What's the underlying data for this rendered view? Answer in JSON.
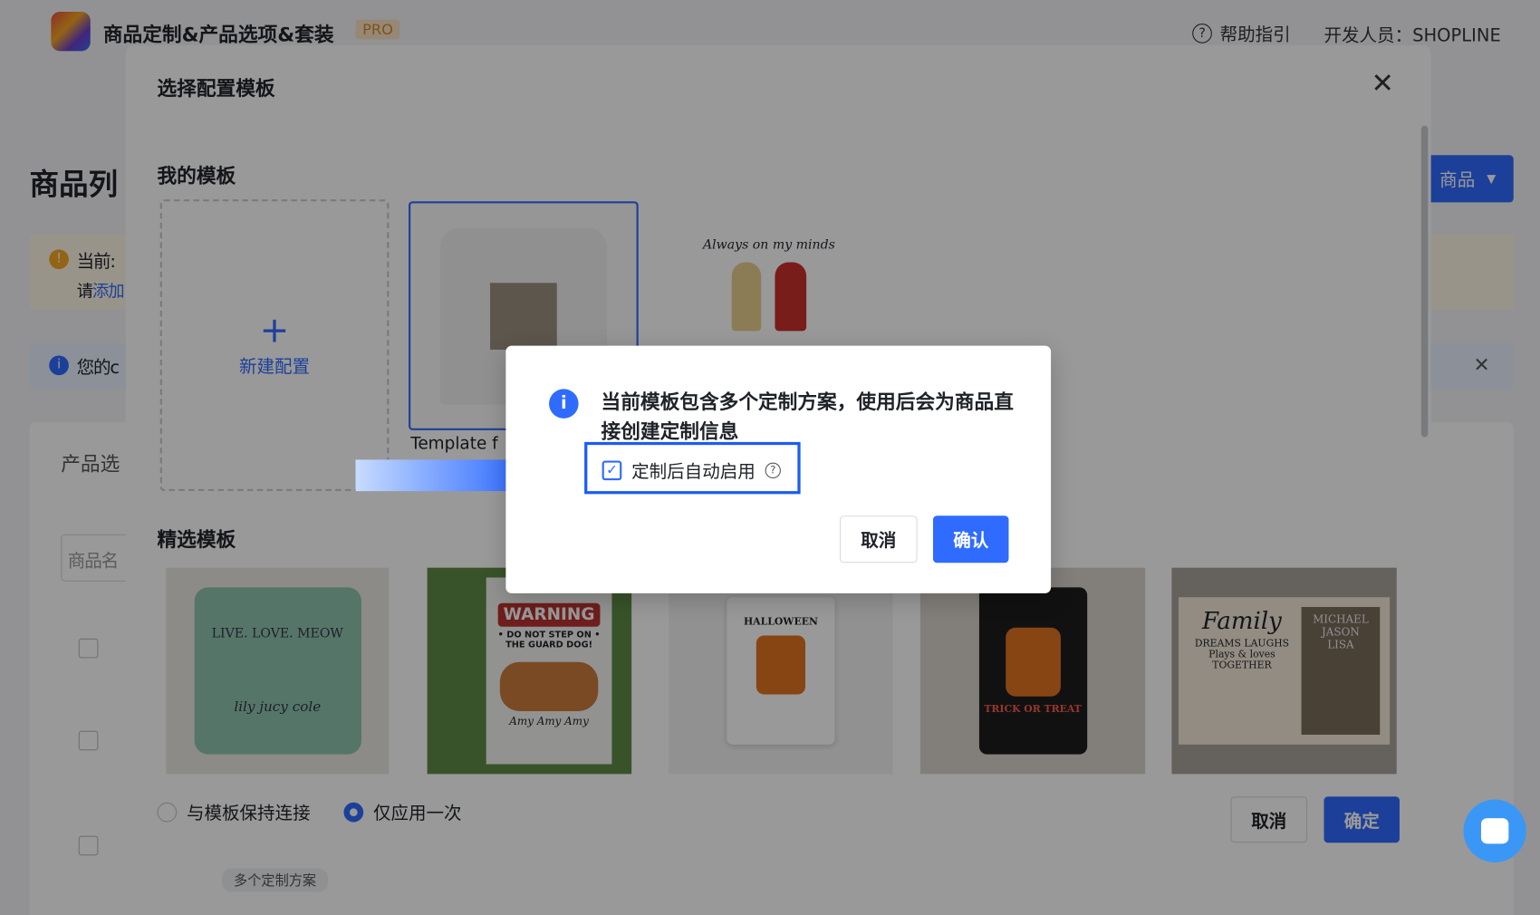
{
  "header": {
    "app_title": "商品定制&产品选项&套装",
    "badge": "PRO",
    "help_label": "帮助指引",
    "developer_label": "开发人员：SHOPLINE"
  },
  "page": {
    "title": "商品列",
    "add_button": "商品",
    "warning_line1": "当前:",
    "warning_line2_prefix": "请",
    "warning_link": "添加",
    "info_text": "您的c",
    "card_title": "产品选",
    "search_placeholder": "商品名",
    "tag": "多个定制方案"
  },
  "modal": {
    "title": "选择配置模板",
    "my_templates_heading": "我的模板",
    "new_config_label": "新建配置",
    "template_name": "Template f",
    "third_template_text": "Always on my minds",
    "featured_heading": "精选模板",
    "featured": [
      {
        "line1": "LIVE. LOVE. MEOW",
        "line2": "lily  jucy  cole"
      },
      {
        "line1": "WARNING",
        "line2": "• DO NOT STEP ON • THE GUARD DOG!",
        "line3": "Amy  Amy  Amy"
      },
      {
        "line1": "HALLOWEEN"
      },
      {
        "line1": "TRICK OR TREAT"
      },
      {
        "line1": "Family",
        "line2": "DREAMS LAUGHS Plays & loves TOGETHER",
        "line3": "MICHAEL JASON LISA"
      }
    ],
    "radio_keep_linked": "与模板保持连接",
    "radio_apply_once": "仅应用一次",
    "selected_radio": "仅应用一次",
    "cancel": "取消",
    "confirm": "确定"
  },
  "dialog": {
    "message": "当前模板包含多个定制方案，使用后会为商品直接创建定制信息",
    "checkbox_label": "定制后自动启用",
    "checkbox_checked": true,
    "cancel": "取消",
    "confirm": "确认"
  },
  "colors": {
    "primary": "#2f6bff",
    "chat": "#3a97f5"
  }
}
